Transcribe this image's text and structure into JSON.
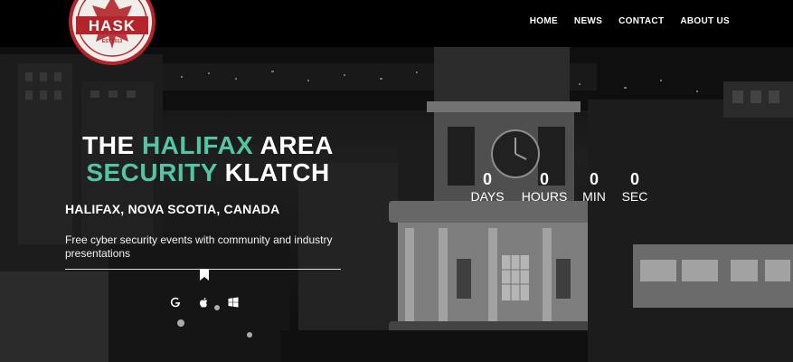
{
  "brand": {
    "logo_text": "HASK",
    "logo_est": "EST 2013",
    "accent_color": "#53c5a5",
    "logo_red": "#b3242b"
  },
  "nav": {
    "items": [
      {
        "label": "HOME"
      },
      {
        "label": "NEWS"
      },
      {
        "label": "CONTACT"
      },
      {
        "label": "ABOUT US"
      }
    ]
  },
  "hero": {
    "headline_line1_a": "THE ",
    "headline_line1_b": "HALIFAX",
    "headline_line1_c": " AREA",
    "headline_line2_a": "SECURITY",
    "headline_line2_b": " KLATCH",
    "location": "HALIFAX, NOVA SCOTIA, CANADA",
    "tagline": "Free cyber security events with community and industry presentations",
    "platform_icons": [
      "google-icon",
      "apple-icon",
      "windows-icon"
    ]
  },
  "countdown": {
    "days": {
      "value": "0",
      "label": "DAYS"
    },
    "hours": {
      "value": "0",
      "label": "HOURS"
    },
    "minutes": {
      "value": "0",
      "label": "MIN"
    },
    "seconds": {
      "value": "0",
      "label": "SEC"
    }
  }
}
